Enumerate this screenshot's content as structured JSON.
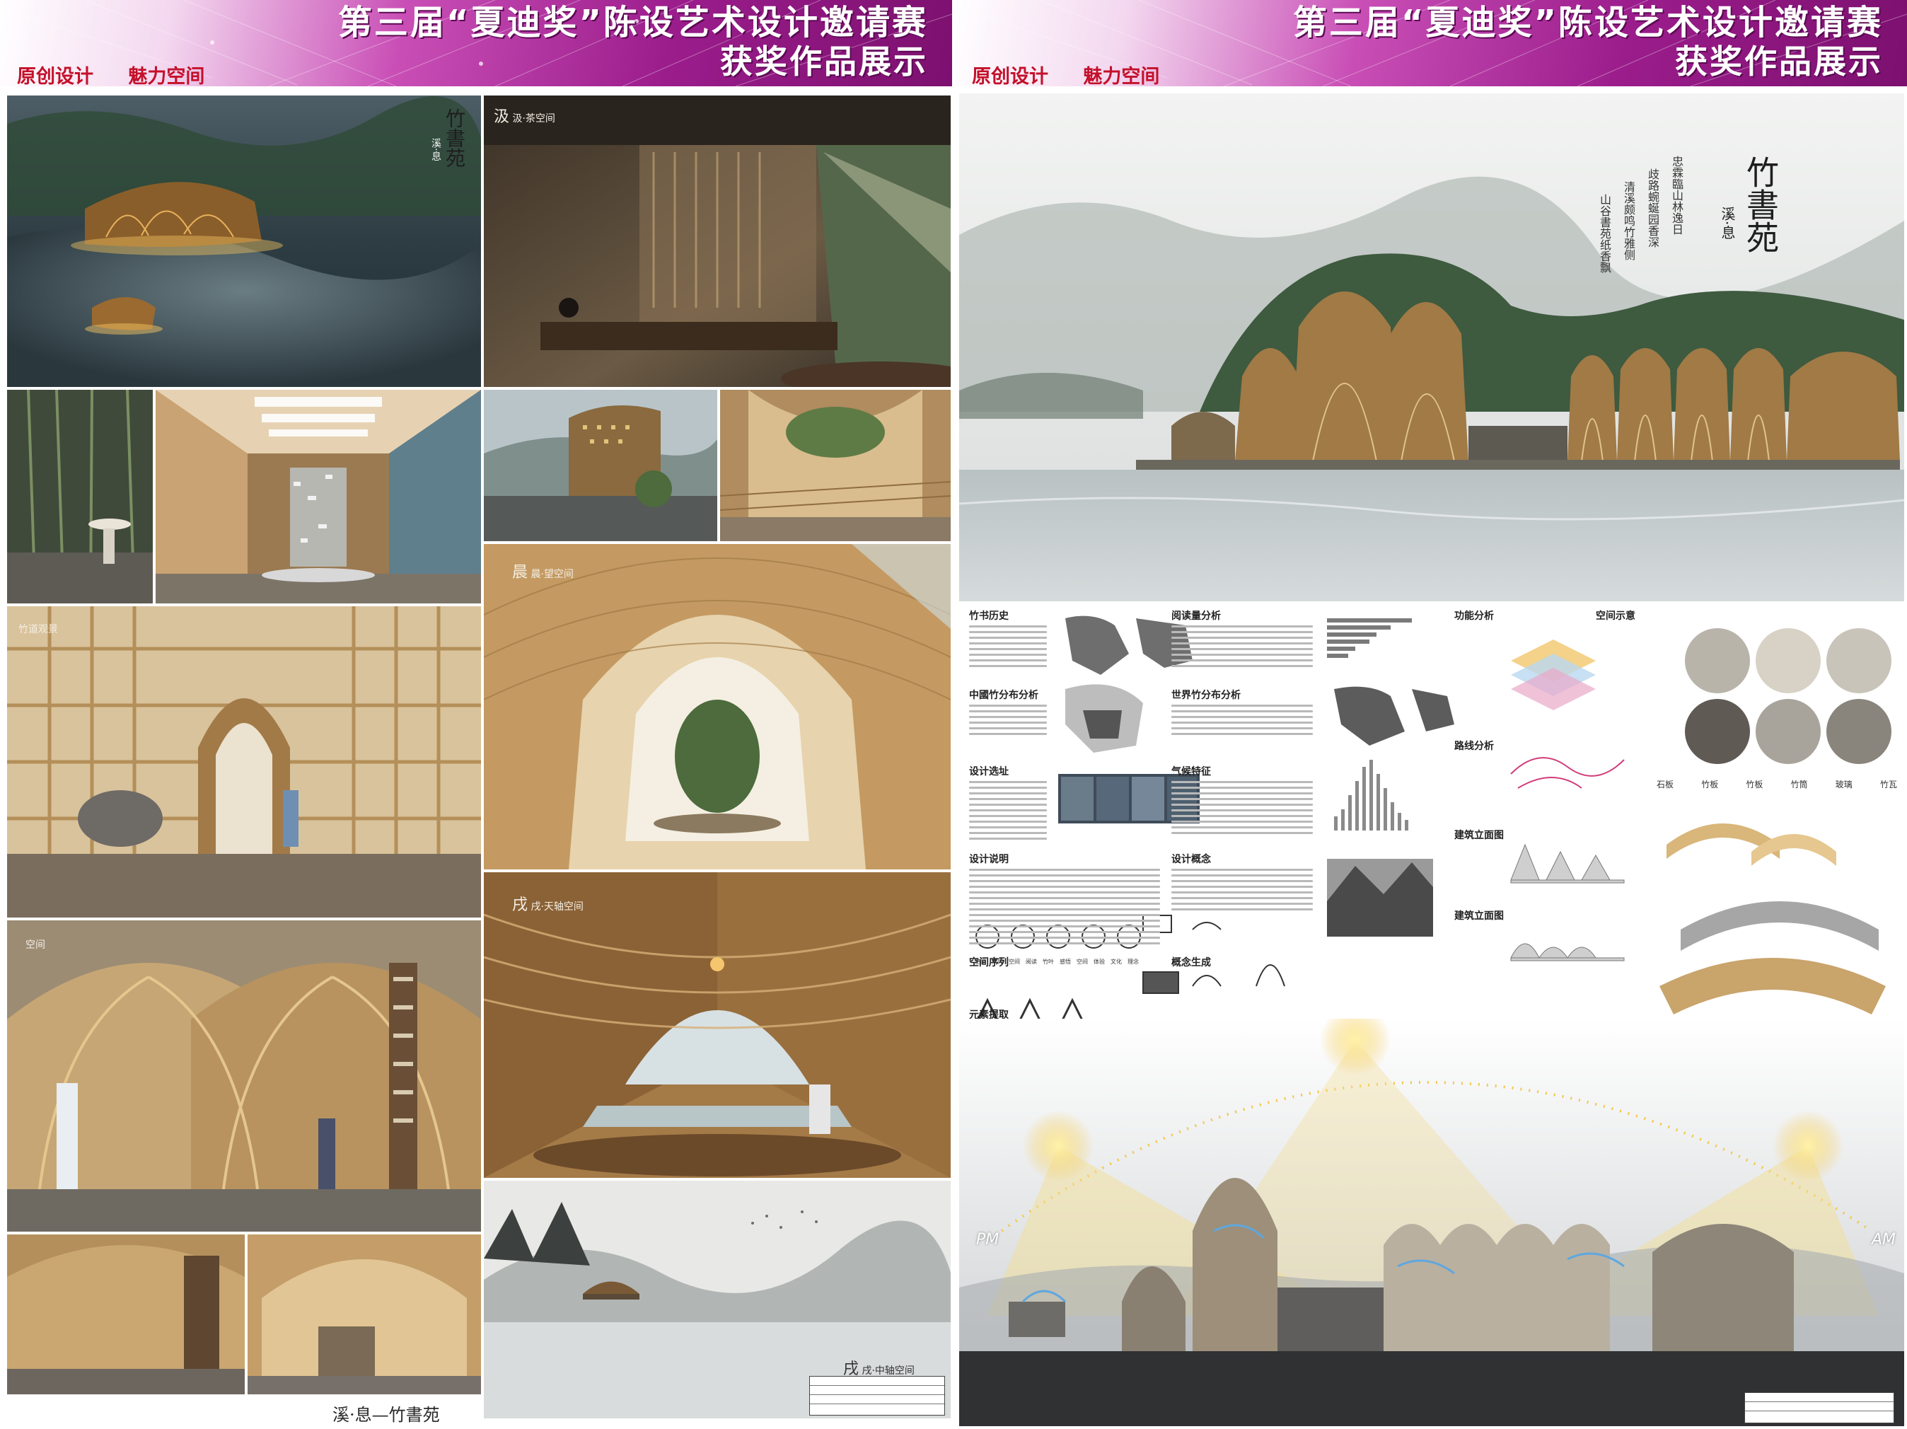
{
  "banner": {
    "title_line1": "第三届“夏迪奖”陈设艺术设计邀请赛",
    "title_line2": "获奖作品展示",
    "slogan_left": "原创设计",
    "slogan_right": "魅力空间",
    "colors": {
      "gradient_start": "#ffffff",
      "gradient_mid": "#c94fb6",
      "gradient_end": "#7c106f",
      "slogan": "#c4102a"
    }
  },
  "left_board": {
    "hero_logo": "竹書苑",
    "hero_logo_sub": "溪·息",
    "tile_captions": {
      "tea": "汲",
      "tea_label": "汲·茶空间",
      "morning": "晨",
      "morning_label": "晨·望空间",
      "bamboo_path": "竹道观景",
      "study": "空间",
      "dusk": "戌",
      "dusk_label": "戌·天轴空间",
      "dusk_bottom_label": "戌·中轴空间"
    },
    "footer_brand": "溪·息—竹書苑"
  },
  "right_board": {
    "hero_logo": "竹書苑",
    "hero_logo_sub": "溪·息",
    "hero_poem": [
      "忠霖臨山林逸日",
      "歧路蜿蜒园香深",
      "清溪颇鸣竹雅侧",
      "山谷書苑纸香飘"
    ],
    "section_headings": [
      "竹书历史",
      "阅读量分析",
      "功能分析",
      "空间示意",
      "中國竹分布分析",
      "世界竹分布分析",
      "路线分析",
      "设计选址",
      "气候特征",
      "建筑立面图",
      "设计说明",
      "设计概念",
      "建筑立面图",
      "空间序列",
      "概念生成",
      "元素提取"
    ],
    "material_labels": [
      "石板",
      "竹板",
      "竹板",
      "竹筒",
      "玻璃",
      "竹瓦"
    ],
    "sequence_words": [
      "空间",
      "序列",
      "空间",
      "阅读",
      "竹叶",
      "感悟",
      "空间",
      "体验",
      "文化",
      "理念"
    ],
    "sun_labels": {
      "pm": "PM",
      "am": "AM"
    }
  }
}
